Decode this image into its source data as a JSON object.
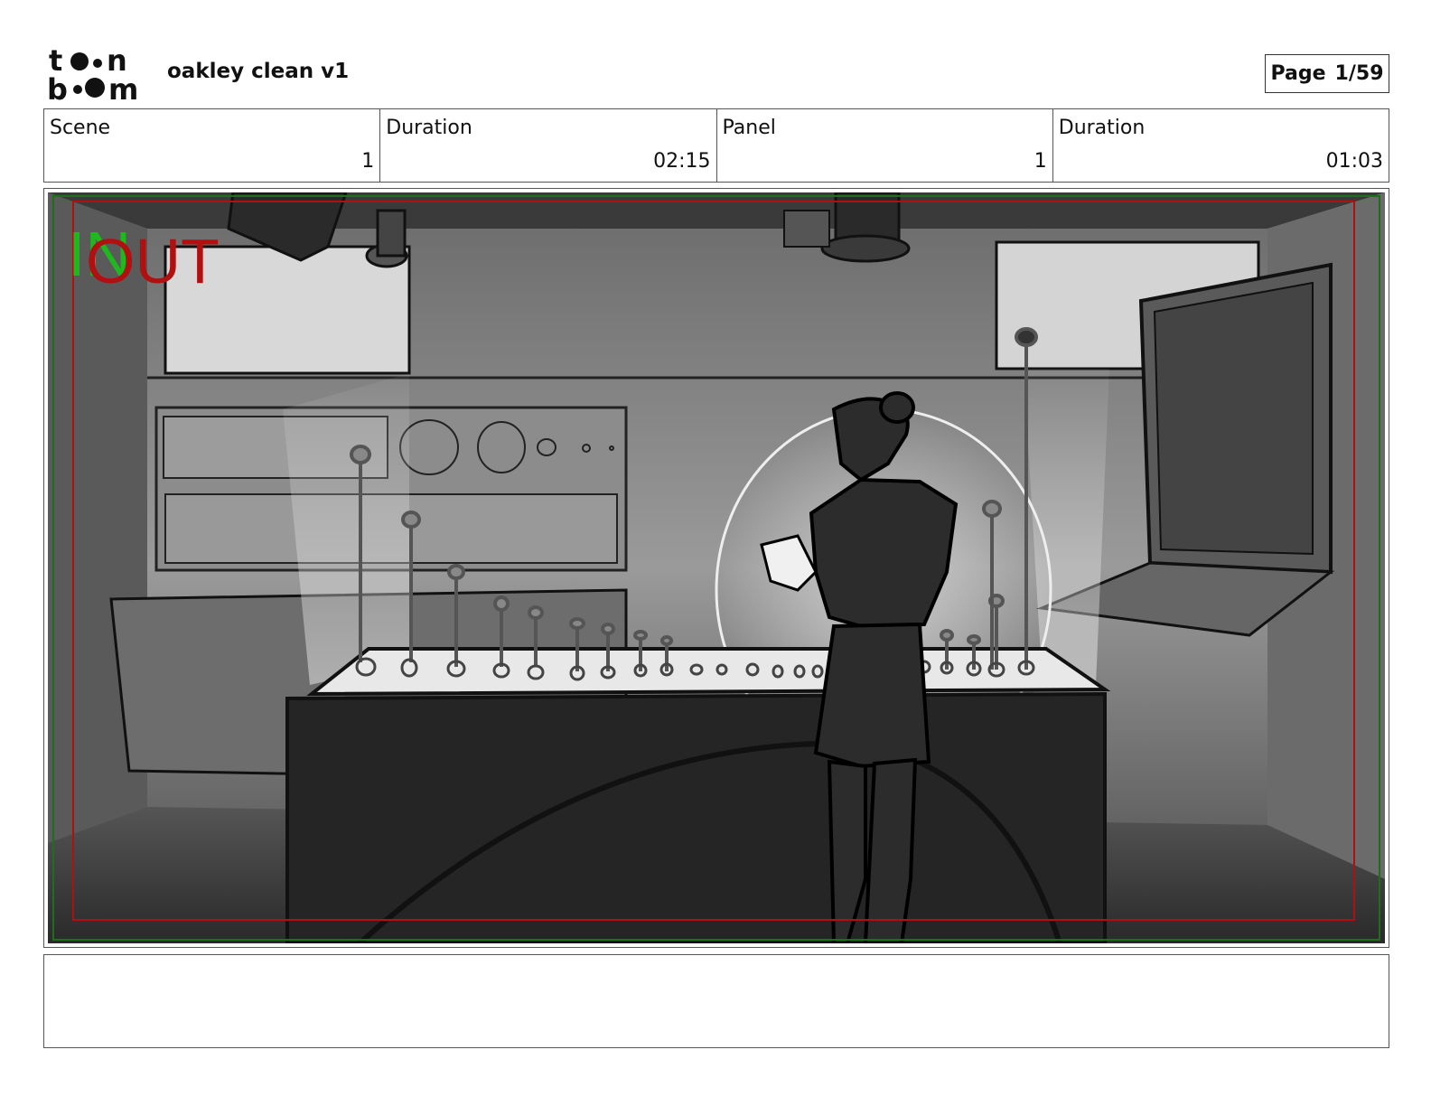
{
  "header": {
    "logo_text": "toon boom",
    "title": "oakley clean v1",
    "page_label": "Page",
    "page_value": "1/59"
  },
  "info": {
    "scene_label": "Scene",
    "scene_value": "1",
    "scene_duration_label": "Duration",
    "scene_duration_value": "02:15",
    "panel_label": "Panel",
    "panel_value": "1",
    "panel_duration_label": "Duration",
    "panel_duration_value": "01:03"
  },
  "panel": {
    "in_marker": "IN",
    "out_marker": "OUT",
    "in_color": "#1fb81f",
    "out_color": "#b01010"
  },
  "notes": {
    "text": ""
  }
}
